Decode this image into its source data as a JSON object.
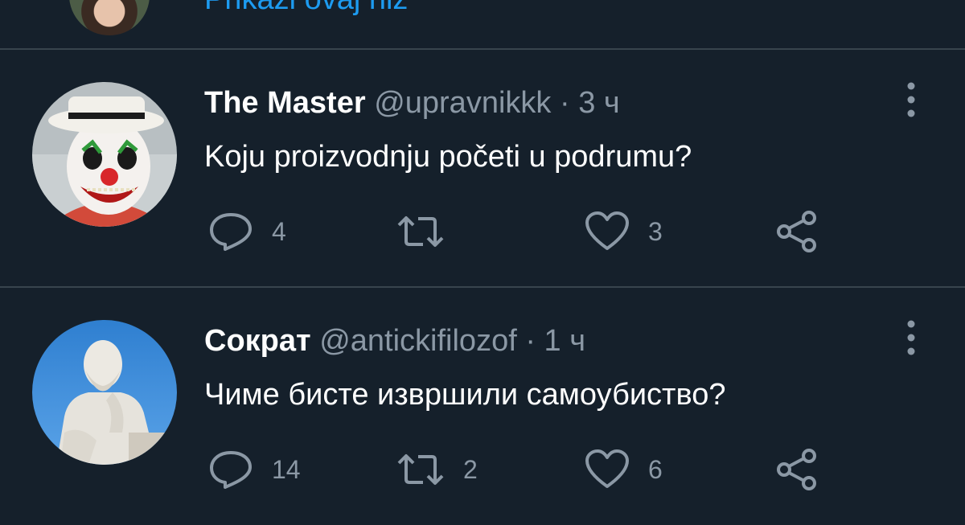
{
  "thread_link": {
    "label": "Prikaži ovaj niz"
  },
  "tweets": [
    {
      "name": "The Master",
      "handle": "@upravnikkk",
      "separator": "·",
      "time": "3 ч",
      "text": "Koju proizvodnju početi u podrumu?",
      "replies": "4",
      "retweets": "",
      "likes": "3"
    },
    {
      "name": "Сократ",
      "handle": "@antickifilozof",
      "separator": "·",
      "time": "1 ч",
      "text": "Чиме бисте извршили самоубиство?",
      "replies": "14",
      "retweets": "2",
      "likes": "6"
    }
  ],
  "icons": {
    "reply": "reply-icon",
    "retweet": "retweet-icon",
    "like": "heart-icon",
    "share": "share-icon",
    "more": "more-vertical-icon"
  },
  "colors": {
    "background": "#15202b",
    "divider": "#38444d",
    "secondary_text": "#8b98a5",
    "link": "#1d9bf0"
  }
}
